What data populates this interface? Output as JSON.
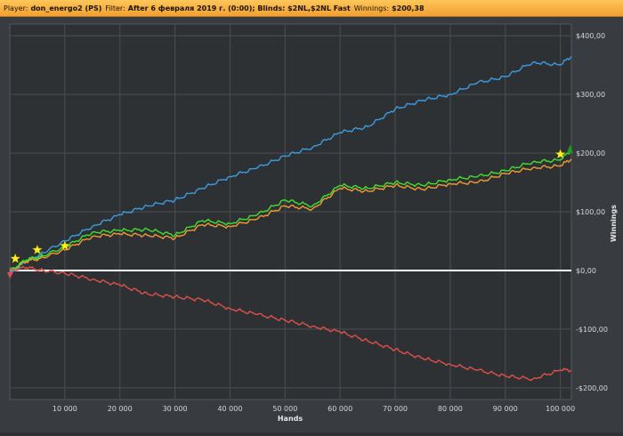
{
  "titlebar": {
    "player_label": "Player:",
    "player_value": "don_energo2 (PS)",
    "filter_label": "Filter:",
    "filter_value": "After 6 февраля 2019 г. (0:00); Blinds: $2NL,$2NL Fast",
    "winnings_label": "Winnings:",
    "winnings_value": "$200,38"
  },
  "chart_data": {
    "type": "line",
    "xlabel": "Hands",
    "ylabel": "Winnings",
    "xlim": [
      0,
      102000
    ],
    "ylim": [
      -220,
      420
    ],
    "x_ticks": [
      10000,
      20000,
      30000,
      40000,
      50000,
      60000,
      70000,
      80000,
      90000,
      100000
    ],
    "x_tick_labels": [
      "10 000",
      "20 000",
      "30 000",
      "40 000",
      "50 000",
      "60 000",
      "70 000",
      "80 000",
      "90 000",
      "100 000"
    ],
    "y_ticks": [
      -200,
      -100,
      0,
      100,
      200,
      300,
      400
    ],
    "y_tick_labels": [
      "-$200,00",
      "-$100,00",
      "$0,00",
      "$100,00",
      "$200,00",
      "$300,00",
      "$400,00"
    ],
    "grid": true,
    "zero_line": true,
    "colors": {
      "blue": "#3c9be0",
      "red": "#e0504a",
      "green": "#40e030",
      "orange": "#f09a35",
      "star": "#ffee22",
      "zero": "#ffffff"
    },
    "series": [
      {
        "color_key": "blue",
        "x": [
          0,
          3000,
          6000,
          10000,
          15000,
          20000,
          25000,
          30000,
          35000,
          40000,
          45000,
          50000,
          55000,
          60000,
          65000,
          70000,
          75000,
          80000,
          85000,
          90000,
          95000,
          100000,
          102000
        ],
        "y": [
          -5,
          15,
          30,
          50,
          75,
          95,
          110,
          120,
          140,
          160,
          175,
          195,
          210,
          235,
          245,
          275,
          290,
          300,
          320,
          330,
          355,
          350,
          365
        ]
      },
      {
        "color_key": "green",
        "x": [
          0,
          3000,
          6000,
          10000,
          15000,
          20000,
          25000,
          30000,
          35000,
          40000,
          45000,
          50000,
          55000,
          60000,
          65000,
          70000,
          75000,
          80000,
          85000,
          90000,
          95000,
          100000,
          102000
        ],
        "y": [
          0,
          18,
          25,
          40,
          65,
          68,
          70,
          60,
          85,
          80,
          95,
          120,
          110,
          145,
          140,
          150,
          145,
          155,
          160,
          170,
          185,
          188,
          205
        ]
      },
      {
        "color_key": "orange",
        "x": [
          0,
          3000,
          6000,
          10000,
          15000,
          20000,
          25000,
          30000,
          35000,
          40000,
          45000,
          50000,
          55000,
          60000,
          65000,
          70000,
          75000,
          80000,
          85000,
          90000,
          95000,
          100000,
          102000
        ],
        "y": [
          0,
          15,
          22,
          35,
          58,
          62,
          60,
          55,
          78,
          75,
          88,
          110,
          105,
          140,
          135,
          145,
          138,
          148,
          150,
          165,
          175,
          178,
          190
        ]
      },
      {
        "color_key": "red",
        "x": [
          0,
          3000,
          6000,
          10000,
          15000,
          20000,
          25000,
          30000,
          35000,
          40000,
          45000,
          50000,
          55000,
          60000,
          65000,
          70000,
          75000,
          80000,
          85000,
          90000,
          95000,
          100000,
          102000
        ],
        "y": [
          0,
          5,
          0,
          -5,
          -15,
          -25,
          -40,
          -45,
          -50,
          -65,
          -75,
          -85,
          -95,
          -105,
          -120,
          -135,
          -150,
          -160,
          -170,
          -180,
          -185,
          -170,
          -170
        ]
      }
    ],
    "stars": [
      {
        "x": 1000,
        "y": 20
      },
      {
        "x": 5000,
        "y": 35
      },
      {
        "x": 10000,
        "y": 42
      },
      {
        "x": 100000,
        "y": 198
      }
    ]
  }
}
